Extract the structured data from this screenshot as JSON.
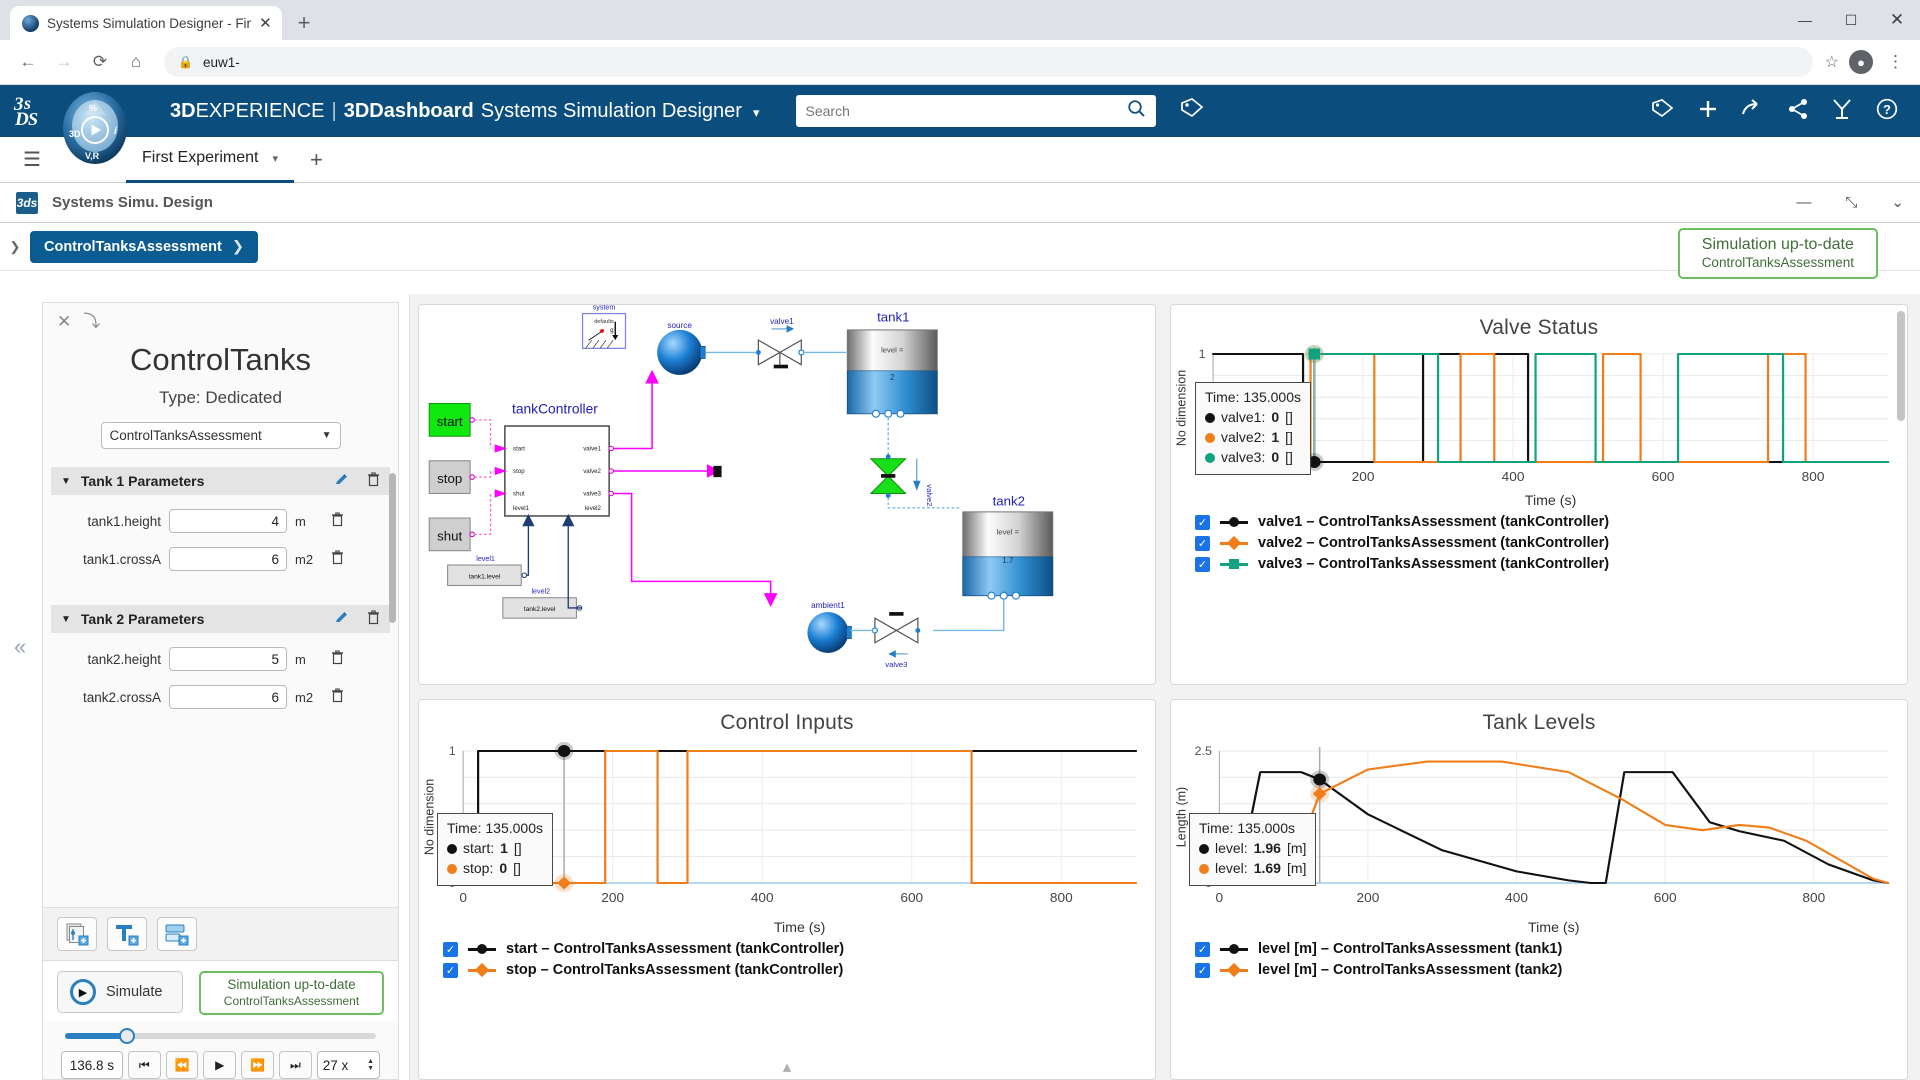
{
  "browser": {
    "tab_title": "Systems Simulation Designer - Fir",
    "close_label": "✕",
    "newtab_label": "+",
    "back": "←",
    "forward": "→",
    "reload": "⟳",
    "home": "⌂",
    "lock": "🔒",
    "url": "euw1-",
    "star": "☆",
    "account": "👤",
    "menu": "⋮",
    "minimize": "—",
    "maximize": "☐",
    "close_win": "✕"
  },
  "topbar": {
    "logo": "3DS",
    "brand_bold": "3D",
    "brand_rest": "EXPERIENCE",
    "separator": "|",
    "dashboard": "3DDashboard",
    "app_name": "Systems Simulation Designer",
    "chevron": "▾",
    "search_placeholder": "Search",
    "search_value": "",
    "search_icon": "🔍",
    "tag_icon": "🏷",
    "actions": [
      "🏷",
      "＋",
      "➦",
      "⤳",
      "✇",
      "?"
    ],
    "bg_color": "#0b4e7e"
  },
  "dashtabs": {
    "hamburger": "☰",
    "tab_label": "First Experiment",
    "tab_caret": "▾",
    "add_tab": "+"
  },
  "apphdr": {
    "icon_label": "3ds",
    "title": "Systems Simu. Design",
    "minimize": "—",
    "restore": "⤡",
    "chevron": "⌄"
  },
  "breadcrumb": {
    "expand": "❯",
    "label": "ControlTanksAssessment",
    "chevron": "❯"
  },
  "sim_status_badge": {
    "line1": "Simulation up-to-date",
    "line2": "ControlTanksAssessment",
    "border_color": "#6cbf5f",
    "text_color": "#3f6e38"
  },
  "left_panel": {
    "close_icon": "✕",
    "collapse_icon": "⤵",
    "title": "ControlTanks",
    "subtitle": "Type: Dedicated",
    "select_value": "ControlTanksAssessment",
    "select_arrow": "▼",
    "collapse_handle": "«",
    "groups": [
      {
        "title": "Tank 1 Parameters",
        "triangle": "▼",
        "edit_icon": "✎",
        "delete_icon": "🗑",
        "params": [
          {
            "name": "tank1.height",
            "value": "4",
            "unit": "m",
            "trash": "🗑"
          },
          {
            "name": "tank1.crossA",
            "value": "6",
            "unit": "m2",
            "trash": "🗑"
          }
        ]
      },
      {
        "title": "Tank 2 Parameters",
        "triangle": "▼",
        "edit_icon": "✎",
        "delete_icon": "🗑",
        "params": [
          {
            "name": "tank2.height",
            "value": "5",
            "unit": "m",
            "trash": "🗑"
          },
          {
            "name": "tank2.crossA",
            "value": "6",
            "unit": "m2",
            "trash": "🗑"
          }
        ]
      }
    ],
    "add_buttons": [
      {
        "name": "add-parameter-button"
      },
      {
        "name": "add-text-button"
      },
      {
        "name": "add-table-button"
      }
    ],
    "simulate_label": "Simulate",
    "simulate_play": "▶",
    "run_badge": {
      "line1": "Simulation up-to-date",
      "line2": "ControlTanksAssessment"
    },
    "playback": {
      "time_value": "136.8 s",
      "first": "⏮",
      "prev": "⏪",
      "play": "▶",
      "next": "⏩",
      "last": "⏭",
      "speed_value": "27 x",
      "spin_up": "▲",
      "spin_down": "▼"
    }
  },
  "diagram": {
    "labels": {
      "system": "system",
      "defaults": "defaults",
      "gravity": "g",
      "source": "source",
      "valve1": "valve1",
      "valve2": "valve2",
      "valve3": "valve3",
      "tank1": "tank1",
      "tank2": "tank2",
      "tank_controller": "tankController",
      "ambient1": "ambient1",
      "start": "start",
      "stop": "stop",
      "shut": "shut",
      "level1": "level1",
      "level2": "level2",
      "tank1_level_block": "tank1.level",
      "tank2_level_block": "tank2.level",
      "ctrl_in_start": "start",
      "ctrl_in_stop": "stop",
      "ctrl_in_shut": "shut",
      "ctrl_in_level1": "level1",
      "ctrl_out_valve1": "valve1",
      "ctrl_out_valve2": "valve2",
      "ctrl_out_valve3": "valve3",
      "ctrl_out_level2": "level2",
      "tank1_level_text": "level =",
      "tank1_level_value": "2",
      "tank2_level_text": "level =",
      "tank2_level_value": "1.7"
    }
  },
  "chart_data": [
    {
      "id": "valve_status",
      "type": "line",
      "title": "Valve Status",
      "xlabel": "Time (s)",
      "ylabel": "No dimension",
      "xlim": [
        0,
        900
      ],
      "ylim": [
        0,
        1
      ],
      "xticks": [
        200,
        400,
        600,
        800
      ],
      "yticks": [
        0,
        1
      ],
      "grid": true,
      "cursor_time": 135.0,
      "tooltip": {
        "time": "Time: 135.000s",
        "rows": [
          {
            "label": "valve1:",
            "value": "0",
            "unit": "[]",
            "color": "#111111"
          },
          {
            "label": "valve2:",
            "value": "1",
            "unit": "[]",
            "color": "#f07d1a"
          },
          {
            "label": "valve3:",
            "value": "0",
            "unit": "[]",
            "color": "#11a37f"
          }
        ]
      },
      "series": [
        {
          "name": "valve1 – ControlTanksAssessment (tankController)",
          "color": "#111111",
          "marker": "circle",
          "checked": true,
          "steps": [
            [
              0,
              1
            ],
            [
              120,
              1
            ],
            [
              120,
              0
            ],
            [
              280,
              0
            ],
            [
              280,
              1
            ],
            [
              420,
              1
            ],
            [
              420,
              0
            ],
            [
              900,
              0
            ]
          ]
        },
        {
          "name": "valve2 – ControlTanksAssessment (tankController)",
          "color": "#f07d1a",
          "marker": "diamond",
          "checked": true,
          "steps": [
            [
              0,
              0
            ],
            [
              130,
              0
            ],
            [
              130,
              1
            ],
            [
              215,
              1
            ],
            [
              215,
              0
            ],
            [
              330,
              0
            ],
            [
              330,
              1
            ],
            [
              375,
              1
            ],
            [
              375,
              0
            ],
            [
              520,
              0
            ],
            [
              520,
              1
            ],
            [
              570,
              1
            ],
            [
              570,
              0
            ],
            [
              740,
              0
            ],
            [
              740,
              1
            ],
            [
              790,
              1
            ],
            [
              790,
              0
            ],
            [
              900,
              0
            ]
          ]
        },
        {
          "name": "valve3 – ControlTanksAssessment (tankController)",
          "color": "#11a37f",
          "marker": "square",
          "checked": true,
          "steps": [
            [
              0,
              0
            ],
            [
              135,
              0
            ],
            [
              135,
              1
            ],
            [
              300,
              1
            ],
            [
              300,
              0
            ],
            [
              430,
              0
            ],
            [
              430,
              1
            ],
            [
              510,
              1
            ],
            [
              510,
              0
            ],
            [
              620,
              0
            ],
            [
              620,
              1
            ],
            [
              760,
              1
            ],
            [
              760,
              0
            ],
            [
              900,
              0
            ]
          ]
        }
      ]
    },
    {
      "id": "control_inputs",
      "type": "line",
      "title": "Control Inputs",
      "xlabel": "Time (s)",
      "ylabel": "No dimension",
      "xlim": [
        0,
        900
      ],
      "ylim": [
        0,
        1
      ],
      "xticks": [
        0,
        200,
        400,
        600,
        800
      ],
      "yticks": [
        0,
        1
      ],
      "grid": true,
      "cursor_time": 135.0,
      "tooltip": {
        "time": "Time: 135.000s",
        "rows": [
          {
            "label": "start:",
            "value": "1",
            "unit": "[]",
            "color": "#111111"
          },
          {
            "label": "stop:",
            "value": "0",
            "unit": "[]",
            "color": "#f07d1a"
          }
        ]
      },
      "series": [
        {
          "name": "start – ControlTanksAssessment (tankController)",
          "color": "#111111",
          "marker": "circle",
          "checked": true,
          "steps": [
            [
              0,
              0
            ],
            [
              20,
              0
            ],
            [
              20,
              1
            ],
            [
              900,
              1
            ]
          ]
        },
        {
          "name": "stop – ControlTanksAssessment (tankController)",
          "color": "#f07d1a",
          "marker": "diamond",
          "checked": true,
          "steps": [
            [
              0,
              0
            ],
            [
              190,
              0
            ],
            [
              190,
              1
            ],
            [
              260,
              1
            ],
            [
              260,
              0
            ],
            [
              300,
              0
            ],
            [
              300,
              1
            ],
            [
              680,
              1
            ],
            [
              680,
              0
            ],
            [
              900,
              0
            ]
          ]
        }
      ]
    },
    {
      "id": "tank_levels",
      "type": "line",
      "title": "Tank Levels",
      "xlabel": "Time (s)",
      "ylabel": "Length (m)",
      "xlim": [
        0,
        900
      ],
      "ylim": [
        0,
        2.5
      ],
      "xticks": [
        0,
        200,
        400,
        600,
        800
      ],
      "yticks": [
        0,
        2.5
      ],
      "grid": true,
      "cursor_time": 135.0,
      "tooltip": {
        "time": "Time: 135.000s",
        "rows": [
          {
            "label": "level:",
            "value": "1.96",
            "unit": "[m]",
            "color": "#111111"
          },
          {
            "label": "level:",
            "value": "1.69",
            "unit": "[m]",
            "color": "#f07d1a"
          }
        ]
      },
      "series": [
        {
          "name": "level [m] – ControlTanksAssessment (tank1)",
          "color": "#111111",
          "marker": "circle",
          "checked": true,
          "points": [
            [
              0,
              0
            ],
            [
              25,
              0
            ],
            [
              55,
              2.1
            ],
            [
              110,
              2.1
            ],
            [
              135,
              1.96
            ],
            [
              200,
              1.3
            ],
            [
              300,
              0.62
            ],
            [
              400,
              0.22
            ],
            [
              470,
              0.05
            ],
            [
              500,
              0.0
            ],
            [
              520,
              0.0
            ],
            [
              545,
              2.1
            ],
            [
              610,
              2.1
            ],
            [
              660,
              1.15
            ],
            [
              700,
              0.98
            ],
            [
              760,
              0.8
            ],
            [
              820,
              0.35
            ],
            [
              880,
              0.05
            ],
            [
              900,
              0.0
            ]
          ]
        },
        {
          "name": "level [m] – ControlTanksAssessment (tank2)",
          "color": "#f07d1a",
          "marker": "diamond",
          "checked": true,
          "points": [
            [
              0,
              0
            ],
            [
              90,
              0
            ],
            [
              135,
              1.69
            ],
            [
              200,
              2.15
            ],
            [
              280,
              2.3
            ],
            [
              380,
              2.3
            ],
            [
              470,
              2.1
            ],
            [
              540,
              1.6
            ],
            [
              600,
              1.1
            ],
            [
              650,
              1.0
            ],
            [
              700,
              1.1
            ],
            [
              740,
              1.05
            ],
            [
              790,
              0.8
            ],
            [
              840,
              0.4
            ],
            [
              880,
              0.08
            ],
            [
              900,
              0.0
            ]
          ]
        }
      ]
    }
  ]
}
